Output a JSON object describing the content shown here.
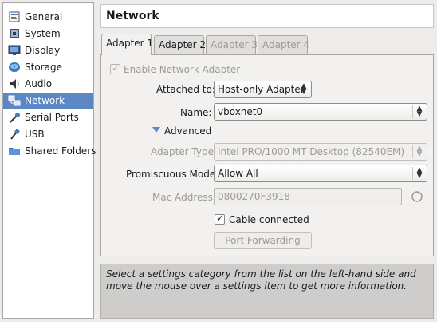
{
  "sidebar": {
    "items": [
      {
        "label": "General",
        "icon": "general-icon"
      },
      {
        "label": "System",
        "icon": "system-icon"
      },
      {
        "label": "Display",
        "icon": "display-icon"
      },
      {
        "label": "Storage",
        "icon": "storage-icon"
      },
      {
        "label": "Audio",
        "icon": "audio-icon"
      },
      {
        "label": "Network",
        "icon": "network-icon",
        "selected": true
      },
      {
        "label": "Serial Ports",
        "icon": "serial-ports-icon"
      },
      {
        "label": "USB",
        "icon": "usb-icon"
      },
      {
        "label": "Shared Folders",
        "icon": "shared-folders-icon"
      }
    ]
  },
  "header": {
    "title": "Network"
  },
  "tabs": [
    {
      "label": "Adapter 1",
      "active": true
    },
    {
      "label": "Adapter 2",
      "active": false
    },
    {
      "label": "Adapter 3",
      "active": false,
      "disabled": true
    },
    {
      "label": "Adapter 4",
      "active": false,
      "disabled": true
    }
  ],
  "adapter": {
    "enable_label": "Enable Network Adapter",
    "enable_checked": true,
    "attached_label": "Attached to:",
    "attached_value": "Host-only Adapter",
    "name_label": "Name:",
    "name_value": "vboxnet0",
    "advanced_label": "Advanced",
    "adapter_type_label": "Adapter Type:",
    "adapter_type_value": "Intel PRO/1000 MT Desktop (82540EM)",
    "promiscuous_label": "Promiscuous Mode:",
    "promiscuous_value": "Allow All",
    "mac_label": "Mac Address:",
    "mac_value": "0800270F3918",
    "cable_label": "Cable connected",
    "cable_checked": true,
    "port_forwarding_label": "Port Forwarding"
  },
  "info": {
    "text": "Select a settings category from the list on the left-hand side and move the mouse over a settings item to get more information."
  },
  "colors": {
    "selection": "#5b87c5",
    "panel_bg": "#f2f1f0",
    "info_bg": "#cfcdcb"
  }
}
